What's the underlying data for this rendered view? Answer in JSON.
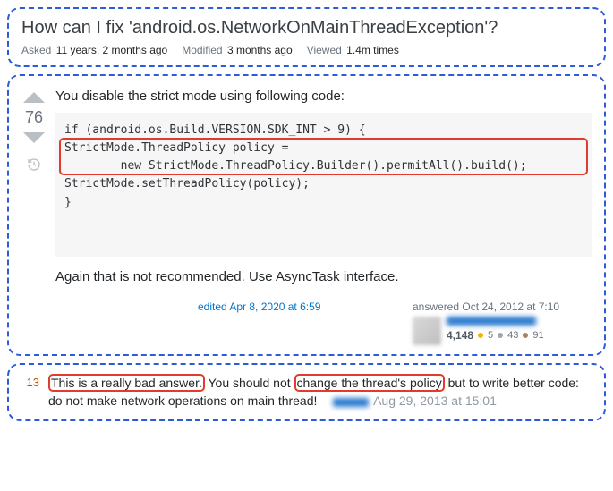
{
  "question": {
    "title": "How can I fix 'android.os.NetworkOnMainThreadException'?",
    "asked_label": "Asked",
    "asked_value": "11 years, 2 months ago",
    "modified_label": "Modified",
    "modified_value": "3 months ago",
    "viewed_label": "Viewed",
    "viewed_value": "1.4m times"
  },
  "answer": {
    "score": "76",
    "intro": "You disable the strict mode using following code:",
    "code_line1": "if (android.os.Build.VERSION.SDK_INT > 9) {",
    "code_line2": "StrictMode.ThreadPolicy policy = ",
    "code_line3": "        new StrictMode.ThreadPolicy.Builder().permitAll().build();",
    "code_line4": "StrictMode.setThreadPolicy(policy);",
    "code_line5": "}",
    "outro": "Again that is not recommended. Use AsyncTask interface.",
    "edited_text": "edited Apr 8, 2020 at 6:59",
    "answered_text": "answered Oct 24, 2012 at 7:10",
    "rep": "4,148",
    "gold": "5",
    "silver": "43",
    "bronze": "91"
  },
  "comment": {
    "score": "13",
    "part1": "This is a really bad answer.",
    "part2": " You should not ",
    "part3": "change the thread's policy",
    "part4": " but to write better code: do not make network operations on main thread! – ",
    "time": "Aug 29, 2013 at 15:01"
  }
}
